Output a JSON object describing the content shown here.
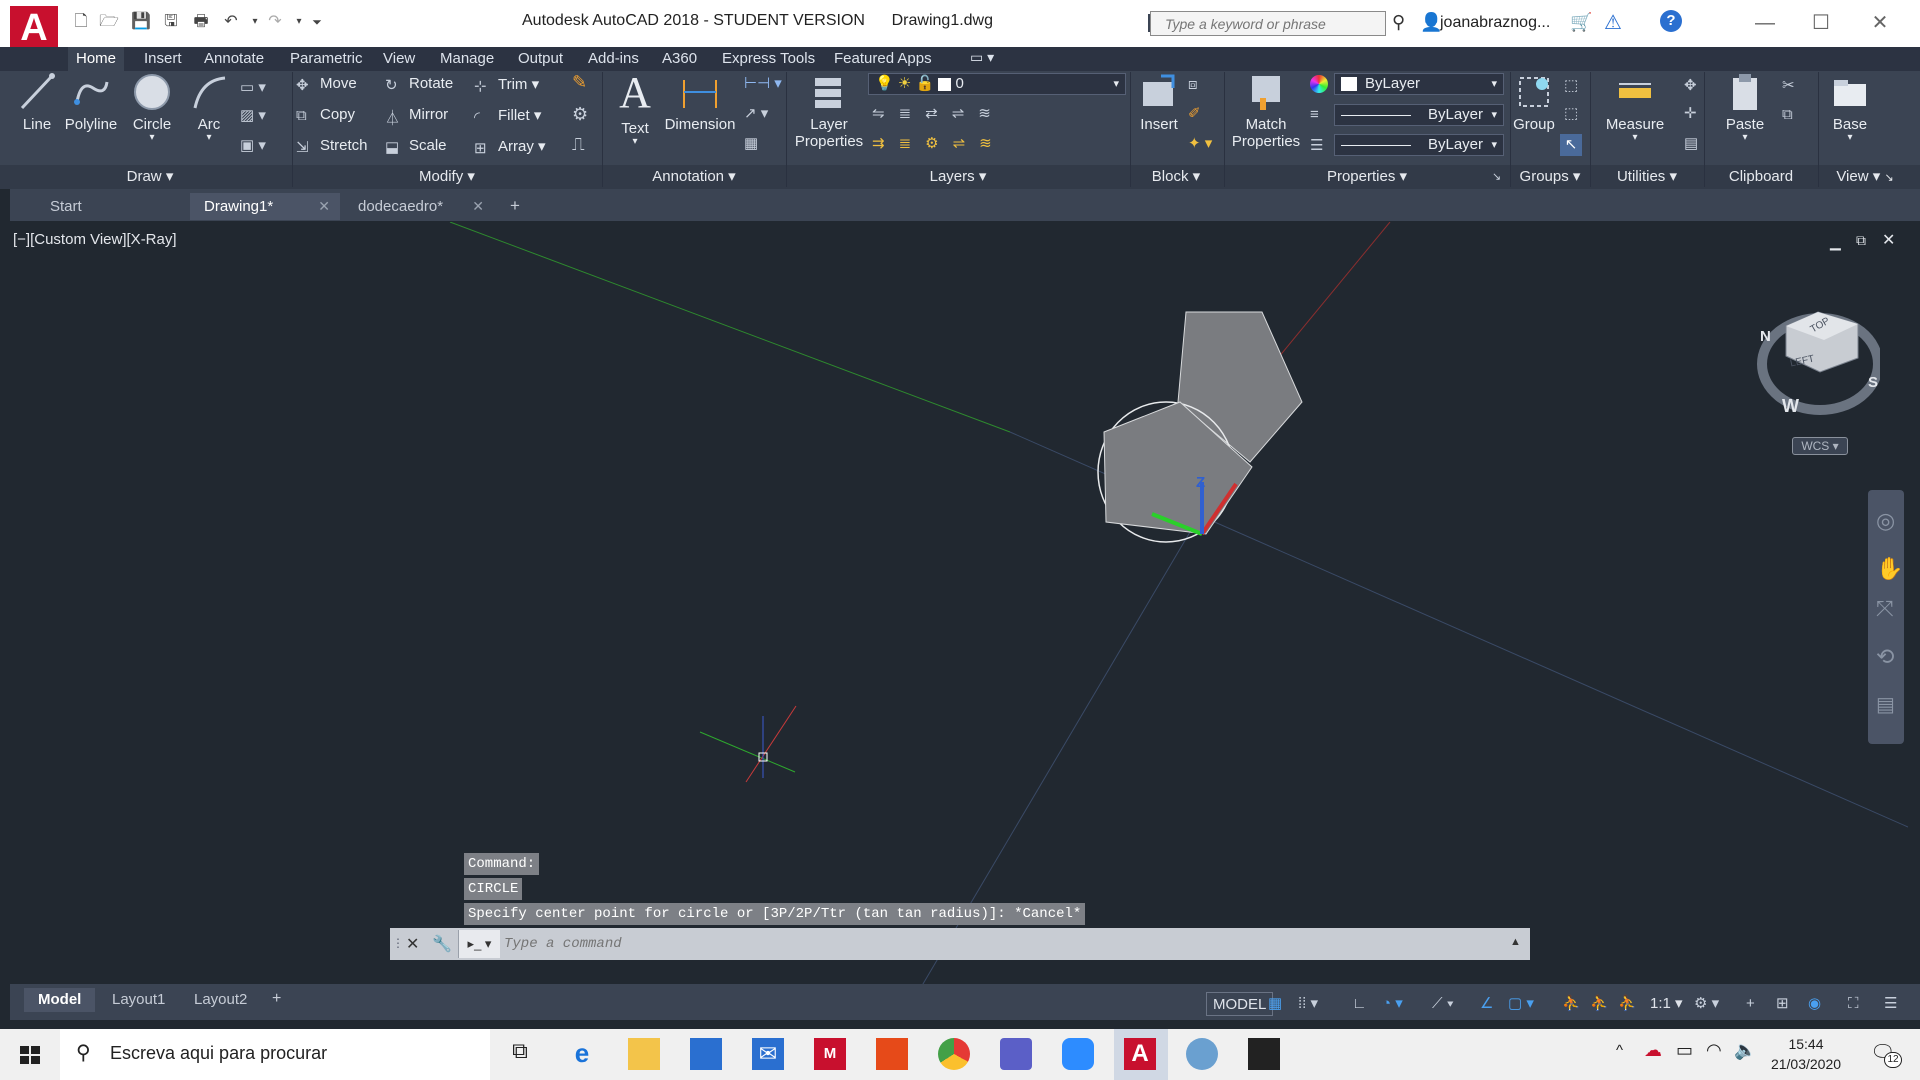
{
  "titlebar": {
    "app_letter": "A",
    "app_title": "Autodesk AutoCAD 2018 - STUDENT VERSION",
    "file_name": "Drawing1.dwg",
    "search_placeholder": "Type a keyword or phrase",
    "user_name": "joanabraznog..."
  },
  "ribbon_tabs": [
    "Home",
    "Insert",
    "Annotate",
    "Parametric",
    "View",
    "Manage",
    "Output",
    "Add-ins",
    "A360",
    "Express Tools",
    "Featured Apps"
  ],
  "draw_panel": {
    "line": "Line",
    "polyline": "Polyline",
    "circle": "Circle",
    "arc": "Arc",
    "label": "Draw"
  },
  "modify_panel": {
    "move": "Move",
    "rotate": "Rotate",
    "trim": "Trim",
    "copy": "Copy",
    "mirror": "Mirror",
    "fillet": "Fillet",
    "stretch": "Stretch",
    "scale": "Scale",
    "array": "Array",
    "label": "Modify"
  },
  "annotation_panel": {
    "text": "Text",
    "dimension": "Dimension",
    "label": "Annotation"
  },
  "layers_panel": {
    "layer_properties_1": "Layer",
    "layer_properties_2": "Properties",
    "current_layer": "0",
    "label": "Layers"
  },
  "block_panel": {
    "insert": "Insert",
    "label": "Block"
  },
  "properties_panel": {
    "match_1": "Match",
    "match_2": "Properties",
    "color": "ByLayer",
    "linetype": "ByLayer",
    "lineweight": "ByLayer",
    "label": "Properties"
  },
  "groups_panel": {
    "group": "Group",
    "label": "Groups"
  },
  "utilities_panel": {
    "measure": "Measure",
    "label": "Utilities"
  },
  "clipboard_panel": {
    "paste": "Paste",
    "label": "Clipboard"
  },
  "view_panel": {
    "base": "Base",
    "label": "View"
  },
  "doc_tabs": {
    "start": "Start",
    "drawing1": "Drawing1*",
    "dodecaedro": "dodecaedro*"
  },
  "viewport": {
    "view_label": "[−][Custom View][X-Ray]",
    "viewcube_top": "TOP",
    "viewcube_left": "LEFT",
    "compass_n": "N",
    "compass_w": "W",
    "compass_s": "S",
    "wcs": "WCS",
    "ucs_z": "Z"
  },
  "command": {
    "history_1": "Command:",
    "history_2": "CIRCLE",
    "history_3": "Specify center point for circle or [3P/2P/Ttr (tan tan radius)]: *Cancel*",
    "input_placeholder": "Type a command"
  },
  "layout_tabs": {
    "model": "Model",
    "layout1": "Layout1",
    "layout2": "Layout2"
  },
  "statusbar": {
    "model": "MODEL",
    "scale": "1:1"
  },
  "taskbar": {
    "search_text": "Escreva aqui para procurar",
    "time": "15:44",
    "date": "21/03/2020",
    "notifications": "12"
  },
  "colors": {
    "accent": "#c8102e",
    "ribbon": "#3b4453",
    "canvas": "#212830"
  }
}
